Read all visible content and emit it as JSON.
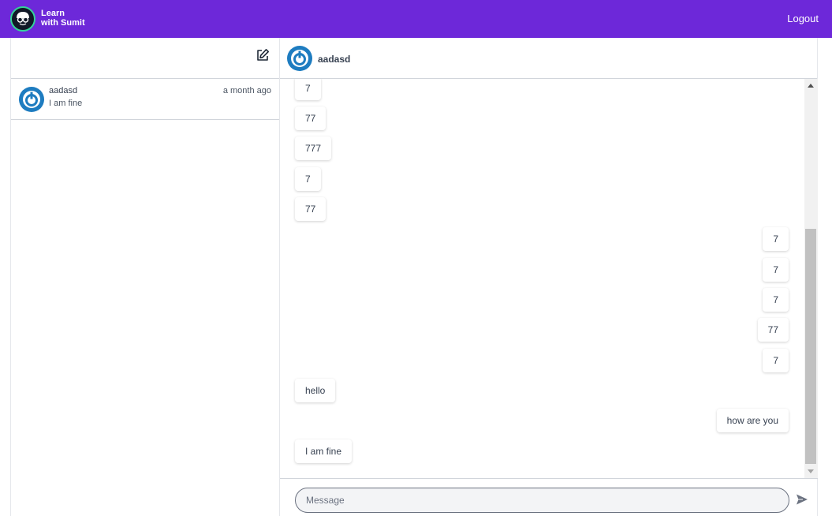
{
  "app": {
    "brand_line1": "Learn",
    "brand_line2": "with Sumit",
    "logout_label": "Logout",
    "accent_color": "#6d28d9"
  },
  "sidebar": {
    "compose_icon": "edit-icon",
    "conversations": [
      {
        "name": "aadasd",
        "time": "a month ago",
        "last_message": "I am fine"
      }
    ]
  },
  "chat": {
    "contact_name": "aadasd",
    "messages": [
      {
        "text": "7",
        "side": "in"
      },
      {
        "text": "77",
        "side": "in"
      },
      {
        "text": "777",
        "side": "in"
      },
      {
        "text": "7",
        "side": "in"
      },
      {
        "text": "77",
        "side": "in"
      },
      {
        "text": "7",
        "side": "out"
      },
      {
        "text": "7",
        "side": "out"
      },
      {
        "text": "7",
        "side": "out"
      },
      {
        "text": "77",
        "side": "out"
      },
      {
        "text": "7",
        "side": "out"
      },
      {
        "text": "hello",
        "side": "in"
      },
      {
        "text": "how are you",
        "side": "out"
      },
      {
        "text": "I am fine",
        "side": "in"
      }
    ],
    "input_placeholder": "Message",
    "send_icon": "send-icon"
  }
}
